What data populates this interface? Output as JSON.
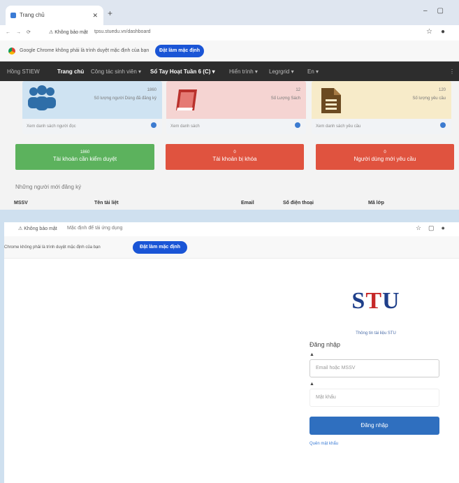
{
  "top_window": {
    "tab_title": "Trang chủ",
    "address": {
      "security_warning": "Không bảo mật",
      "url": "tpsu.stuedu.vn/dashboard"
    },
    "infobar": {
      "message": "Google Chrome không phải là trình duyệt mặc định của bạn",
      "button": "Đặt làm mặc định"
    },
    "menu": {
      "brand": "Hồng STIEW",
      "items": [
        "Trang chủ",
        "Công tác sinh viên ▾",
        "Sổ Tay Hoạt Tuần 6 (C) ▾",
        "Hiển trình ▾",
        "Legrgrid ▾",
        "En ▾"
      ]
    },
    "cards": [
      {
        "count": "1860",
        "label": "Số lượng người Dùng đã đăng ký",
        "footer": "Xem danh sách người đọc",
        "color": "#cfe3f2",
        "icon": "users-icon"
      },
      {
        "count": "12",
        "label": "Số Lượng Sách",
        "footer": "Xem danh sách",
        "color": "#f5d4d2",
        "icon": "book-icon"
      },
      {
        "count": "120",
        "label": "Số lượng yêu cầu",
        "footer": "Xem danh sách yêu cầu",
        "color": "#f7ebc9",
        "icon": "document-icon"
      }
    ],
    "actions": [
      {
        "count": "1860",
        "label": "Tài khoản cần kiểm duyệt",
        "color": "#5cb25d"
      },
      {
        "count": "0",
        "label": "Tài khoản bị khóa",
        "color": "#e0533f"
      },
      {
        "count": "0",
        "label": "Người dùng mới yêu cầu",
        "color": "#e0533f"
      }
    ],
    "recent_title": "Những người mới đăng ký",
    "table_headers": [
      "MSSV",
      "Tên tài liệt",
      "Email",
      "Số điện thoại",
      "Mã lớp"
    ]
  },
  "bottom_window": {
    "address": {
      "security_warning": "Không bảo mật",
      "url": "Mặc định để tải ứng dụng"
    },
    "infobar": {
      "message": "Chrome không phải là trình duyệt mặc định của bạn",
      "button": "Đặt làm mặc định"
    },
    "login": {
      "logo_prefix": "S",
      "logo_accent": "T",
      "logo_suffix": "U",
      "subtitle": "Thông tin tài liệu STU",
      "heading": "Đăng nhập",
      "email_placeholder": "Email hoặc MSSV",
      "password_placeholder": "Mật khẩu",
      "submit": "Đăng nhập",
      "forgot": "Quên mật khẩu"
    }
  }
}
